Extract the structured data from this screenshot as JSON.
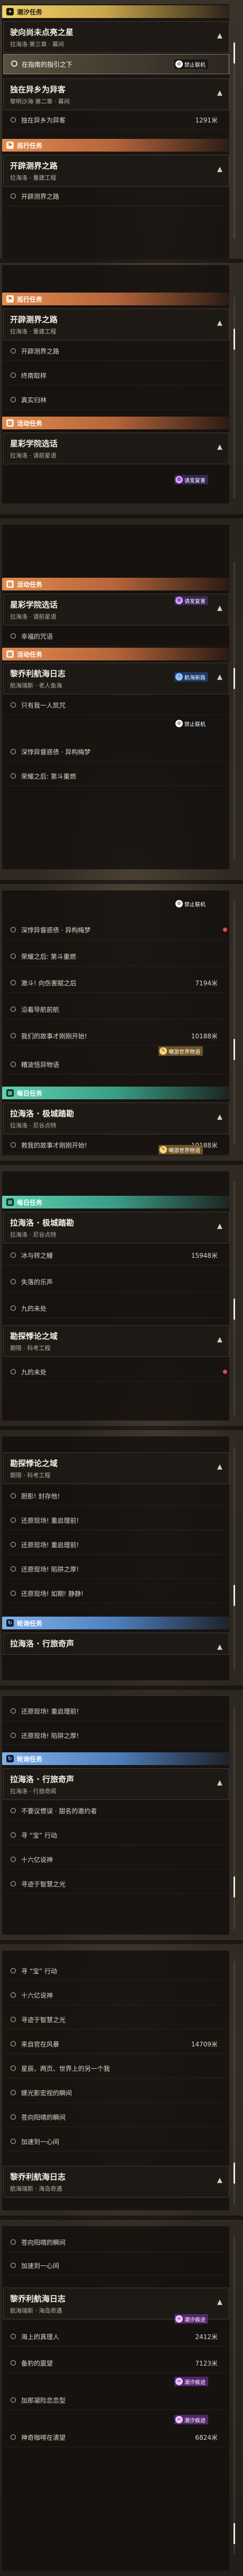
{
  "headers": {
    "tide": "潮汐任务",
    "travel": "巡行任务",
    "event": "活动任务",
    "daily": "每日任务",
    "chirality": "轮询任务"
  },
  "badges": {
    "ban": "禁止联机",
    "friend": "请发复害",
    "navigation": "航海新路",
    "dust": "潮汐痕迹",
    "fame": "嘲游世界物语"
  },
  "quests": {
    "q1": {
      "title": "驶向尚未点亮之星",
      "sub": "拉海洛·第三章 · 幕间"
    },
    "q2": {
      "title": "独在异乡为异客",
      "sub": "黎明沙海·第二章 · 幕间"
    },
    "q3": {
      "title": "开辟测界之路",
      "sub": "拉海洛 · 重建工程"
    },
    "q4": {
      "title": "星彩学院选话",
      "sub": "拉海洛 · 请前星语"
    },
    "q5": {
      "title": "黎乔利航海日志",
      "sub": "航海瑞斯 · 老人鱼海"
    },
    "q6": {
      "title": "拉海洛 · 极城踏勘",
      "sub": "拉海洛 · 尼谷点特"
    },
    "q7": {
      "title": "勘探悸论之域",
      "sub": "期限 · 科考工程"
    },
    "q8": {
      "title": "拉海洛 · 行旅奇声",
      "sub": "拉海洛 · 行旅奇闻"
    },
    "q9": {
      "title": "黎乔利航海日志",
      "sub": "航海瑞斯 · 海岛奇遇"
    }
  },
  "steps": {
    "s1": "在指南的指引之下",
    "s2": "独在异乡为异客",
    "s3": "开辟测界之路",
    "s4": "终南取样",
    "s5": "真实归林",
    "s6": "幸福的咒语",
    "s7": "只有我一人凯咒",
    "s8": "深悖异督惑债 · 异构梅梦",
    "s9": "荣耀之后: 第斗重燃",
    "s10": "激斗! 向伤害赋之后",
    "s11": "沿着导航前航",
    "s12": "我们的故事才刚刚开始!",
    "s13": "糟波悟异物语",
    "s14": "救我的故事才刚刚开始!",
    "s15": "冰与转之鳗",
    "s16": "失落的乐声",
    "s17": "九的未处",
    "s18": "胆影! 封存他!",
    "s19": "还原现场! 重启理前!",
    "s20": "还原现场! 重启理前!",
    "s21": "还原现场! 陷阱之厚!",
    "s22": "还原现场! 如期! 静静!",
    "s23": "不要议惯误 · 甜名的邀约者",
    "s24": "寻 “宝” 行动",
    "s25": "十六亿说神",
    "s26": "寻迹于智慧之光",
    "s27": "来自官在风暴",
    "s28": "星辰、两页、世界上的另一个我",
    "s29": "娜光影宏视的瞬间",
    "s30": "苍向阳晴的瞬间",
    "s31": "加速到一心间",
    "s32": "海上的真理人",
    "s33": "备豹的震望",
    "s34": "加那凝险恋恋型",
    "s35": "神奇咖啡在清望"
  },
  "distances": {
    "d1": "1291米",
    "d2": "7194米",
    "d3": "10188米",
    "d4": "10188米",
    "d5": "15948米",
    "d6": "14709米",
    "d7": "2412米",
    "d8": "7123米",
    "d9": "6824米"
  }
}
